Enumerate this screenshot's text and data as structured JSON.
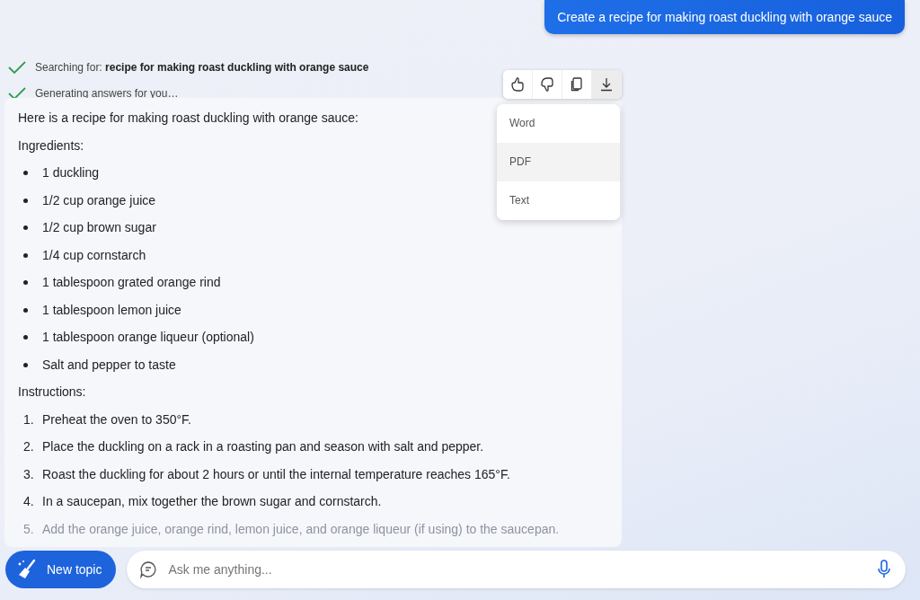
{
  "user_message": "Create a recipe for making roast duckling with orange sauce",
  "status_lines": [
    {
      "text": "Searching for: **recipe for making roast duckling with orange sauce**",
      "done": true
    },
    {
      "text": "Generating answers for you…",
      "done": true
    }
  ],
  "toolbar": [
    {
      "kind": "like",
      "selected": false
    },
    {
      "kind": "dislike",
      "selected": false
    },
    {
      "kind": "copy",
      "selected": false
    },
    {
      "kind": "download",
      "selected": true
    }
  ],
  "export_menu": [
    {
      "label": "Word",
      "selected": false
    },
    {
      "label": "PDF",
      "selected": true
    },
    {
      "label": "Text",
      "selected": false
    }
  ],
  "answer": {
    "intro": "Here is a recipe for making roast duckling with orange sauce:",
    "ingredients_heading": "Ingredients:",
    "ingredients": [
      "1 duckling",
      "1/2 cup orange juice",
      "1/2 cup brown sugar",
      "1/4 cup cornstarch",
      "1 tablespoon grated orange rind",
      "1 tablespoon lemon juice",
      "1 tablespoon orange liqueur (optional)",
      "Salt and pepper to taste"
    ],
    "instructions_heading": "Instructions:",
    "instructions": [
      {
        "number": "1.",
        "text": "Preheat the oven to 350°F."
      },
      {
        "number": "2.",
        "text": "Place the duckling on a rack in a roasting pan and season with salt and pepper."
      },
      {
        "number": "3.",
        "text": "Roast the duckling for about 2 hours or until the internal temperature reaches 165°F."
      },
      {
        "number": "4.",
        "text": "In a saucepan, mix together the brown sugar and cornstarch."
      },
      {
        "number": "5.",
        "text": "Add the orange juice, orange rind, lemon juice, and orange liqueur (if using) to the saucepan."
      }
    ]
  },
  "new_topic_button": "New topic",
  "input": {
    "placeholder": "Ask me anything..."
  }
}
